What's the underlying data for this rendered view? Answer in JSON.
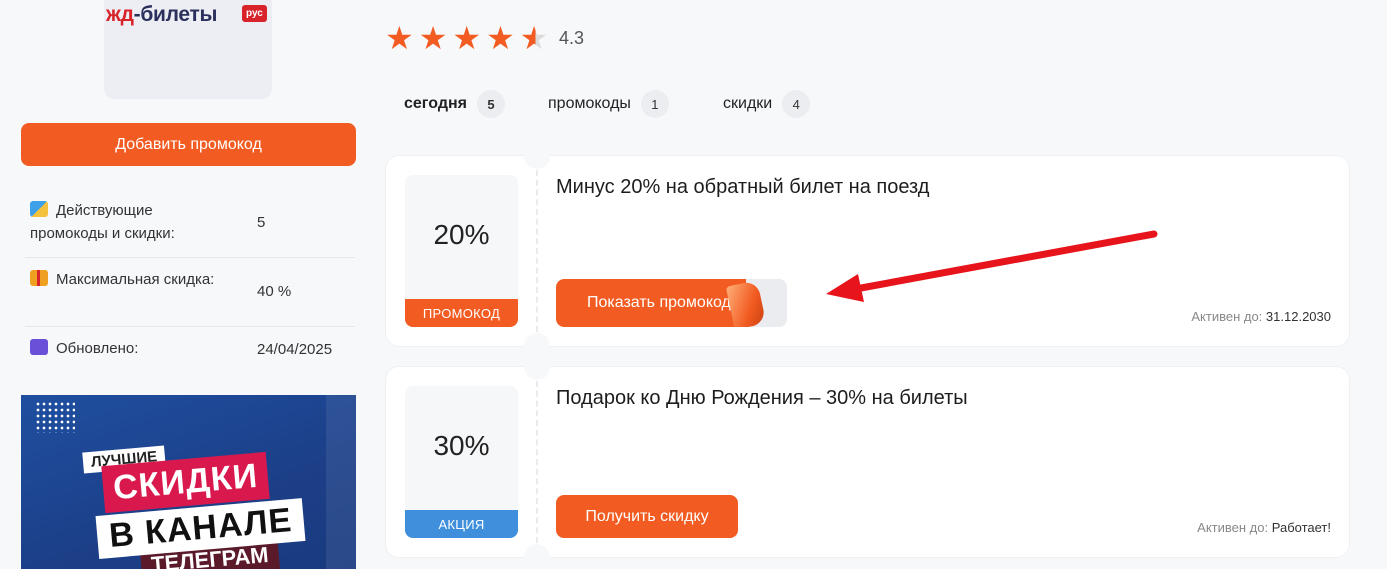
{
  "brand": {
    "logo_highlight": "жд",
    "logo_rest": "-билеты",
    "badge": "рус"
  },
  "sidebar": {
    "add_button": "Добавить промокод",
    "stats": [
      {
        "icon": "shopping-bag-icon",
        "label": "Действующие промокоды и скидки:",
        "value": "5"
      },
      {
        "icon": "gift-icon",
        "label": "Максимальная скидка:",
        "value": "40 %"
      },
      {
        "icon": "clock-icon",
        "label": "Обновлено:",
        "value": "24/04/2025"
      }
    ],
    "banner": {
      "line1": "ЛУЧШИЕ",
      "line2": "СКИДКИ",
      "line3": "В КАНАЛЕ",
      "line4": "ТЕЛЕГРАМ"
    }
  },
  "rating": {
    "value": "4.3",
    "stars": 4.3,
    "max": 5
  },
  "tabs": [
    {
      "label": "сегодня",
      "count": "5"
    },
    {
      "label": "промокоды",
      "count": "1"
    },
    {
      "label": "скидки",
      "count": "4"
    }
  ],
  "offers": [
    {
      "percent": "20%",
      "tag": "ПРОМОКОД",
      "title": "Минус 20% на обратный билет на поезд",
      "button": "Показать промокод",
      "active_label": "Активен до:",
      "active_value": "31.12.2030"
    },
    {
      "percent": "30%",
      "tag": "АКЦИЯ",
      "title": "Подарок ко Дню Рождения – 30% на билеты",
      "button": "Получить скидку",
      "active_label": "Активен до:",
      "active_value": "Работает!"
    }
  ],
  "colors": {
    "accent": "#f25c22",
    "brand_red": "#d8232a",
    "tag_blue": "#3f8fdc",
    "annotation_arrow": "#e8141c"
  }
}
